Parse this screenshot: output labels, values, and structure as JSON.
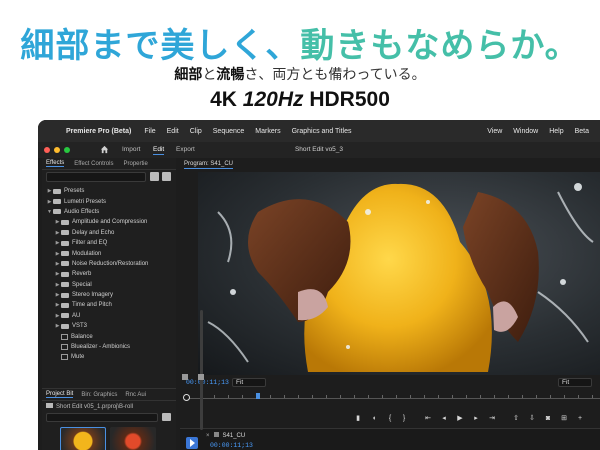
{
  "promo": {
    "headline_part1": "細部まで美しく、",
    "headline_part2": "動きもなめらか。",
    "sub_bold1": "細部",
    "sub_text1": "と",
    "sub_bold2": "流暢",
    "sub_text2": "さ、両方とも備わっている。",
    "spec_4k": "4K ",
    "spec_hz": "120Hz",
    "spec_hdr": " HDR500",
    "colors": {
      "blue": "#2fa6d8",
      "teal": "#45bfa8"
    }
  },
  "menubar": {
    "app_name": "Premiere Pro (Beta)",
    "items": [
      "File",
      "Edit",
      "Clip",
      "Sequence",
      "Markers",
      "Graphics and Titles"
    ],
    "right_items": [
      "View",
      "Window",
      "Help",
      "Beta"
    ]
  },
  "toolbar": {
    "tabs": [
      "Import",
      "Edit",
      "Export"
    ],
    "active_tab": "Edit",
    "title": "Short Edit vo5_3"
  },
  "effects_panel": {
    "tabs": [
      "Effects",
      "Effect Controls",
      "Propertie"
    ],
    "tree": [
      {
        "label": "Presets",
        "level": 0,
        "kind": "folder",
        "open": false
      },
      {
        "label": "Lumetri Presets",
        "level": 0,
        "kind": "folder",
        "open": false
      },
      {
        "label": "Audio Effects",
        "level": 0,
        "kind": "folder",
        "open": true
      },
      {
        "label": "Amplitude and Compression",
        "level": 1,
        "kind": "folder",
        "open": false
      },
      {
        "label": "Delay and Echo",
        "level": 1,
        "kind": "folder",
        "open": false
      },
      {
        "label": "Filter and EQ",
        "level": 1,
        "kind": "folder",
        "open": false
      },
      {
        "label": "Modulation",
        "level": 1,
        "kind": "folder",
        "open": false
      },
      {
        "label": "Noise Reduction/Restoration",
        "level": 1,
        "kind": "folder",
        "open": false
      },
      {
        "label": "Reverb",
        "level": 1,
        "kind": "folder",
        "open": false
      },
      {
        "label": "Special",
        "level": 1,
        "kind": "folder",
        "open": false
      },
      {
        "label": "Stereo Imagery",
        "level": 1,
        "kind": "folder",
        "open": false
      },
      {
        "label": "Time and Pitch",
        "level": 1,
        "kind": "folder",
        "open": false
      },
      {
        "label": "AU",
        "level": 1,
        "kind": "folder",
        "open": false
      },
      {
        "label": "VST3",
        "level": 1,
        "kind": "folder",
        "open": false
      },
      {
        "label": "Balance",
        "level": 1,
        "kind": "effect",
        "open": false
      },
      {
        "label": "Bluealizer - Ambionics",
        "level": 1,
        "kind": "effect",
        "open": false
      },
      {
        "label": "Mute",
        "level": 1,
        "kind": "effect",
        "open": false
      }
    ]
  },
  "project_panel": {
    "tabs": [
      "Project Bit",
      "Bin: Graphics",
      "Rnc Aui"
    ],
    "path": "Short Edit v05_1.prproj\\B-roll"
  },
  "program_monitor": {
    "label": "Program: S41_CU",
    "timecode": "00:00:11;13",
    "fit_left": "Fit",
    "fit_right": "Fit",
    "playhead_fraction": 0.17
  },
  "timeline": {
    "sequence_tab": "S41_CU",
    "timecode": "00:00:11;13"
  },
  "window_colors": {
    "close": "#ff5f57",
    "minimize": "#febc2e",
    "zoom": "#28c840",
    "accent": "#4a90e2"
  }
}
